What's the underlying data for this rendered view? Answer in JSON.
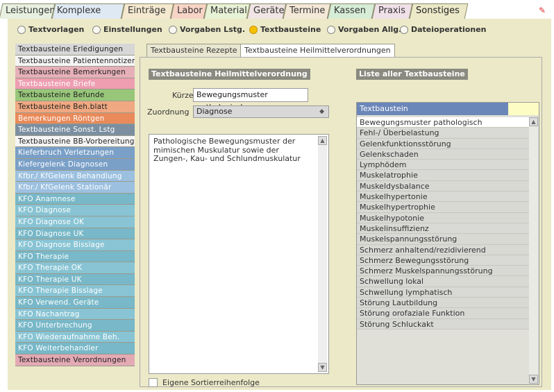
{
  "top_tabs": [
    {
      "label": "Leistungen",
      "color": "#e8f0e0",
      "active": false
    },
    {
      "label": "Komplexe POA",
      "color": "#dfe9f3",
      "active": false
    },
    {
      "label": "Einträge",
      "color": "#f4e9d0",
      "active": false
    },
    {
      "label": "Labor",
      "color": "#f7d4c6",
      "active": false
    },
    {
      "label": "Material",
      "color": "#e8f2d6",
      "active": false
    },
    {
      "label": "Geräte",
      "color": "#f0e4e4",
      "active": false
    },
    {
      "label": "Termine",
      "color": "#f4e8d8",
      "active": false
    },
    {
      "label": "Kassen",
      "color": "#d6ecd6",
      "active": false
    },
    {
      "label": "Praxis",
      "color": "#f0e0e8",
      "active": false
    },
    {
      "label": "Sonstiges",
      "color": "#ece9c8",
      "active": true
    }
  ],
  "radio_options": [
    {
      "label": "Textvorlagen",
      "selected": false
    },
    {
      "label": "Einstellungen",
      "selected": false
    },
    {
      "label": "Vorgaben Lstg.",
      "selected": false
    },
    {
      "label": "Textbausteine",
      "selected": true
    },
    {
      "label": "Vorgaben Allg.",
      "selected": false
    },
    {
      "label": "Dateioperationen",
      "selected": false
    }
  ],
  "left_list": [
    {
      "label": "Textbausteine Erledigungen",
      "cls": "c-grey"
    },
    {
      "label": "Textbausteine Patientennotizen",
      "cls": "c-white"
    },
    {
      "label": "Textbausteine Bemerkungen",
      "cls": "c-pink"
    },
    {
      "label": "Textbausteine Briefe",
      "cls": "c-rose"
    },
    {
      "label": "Textbausteine Befunde",
      "cls": "c-green"
    },
    {
      "label": "Textbausteine Beh.blatt",
      "cls": "c-orange"
    },
    {
      "label": "Bemerkungen Röntgen",
      "cls": "c-orange2"
    },
    {
      "label": "Textbausteine Sonst. Lstg",
      "cls": "c-slate"
    },
    {
      "label": "Textbausteine BB-Vorbereitung",
      "cls": "c-white"
    },
    {
      "label": "Kieferbruch Verletzungen",
      "cls": "c-blue"
    },
    {
      "label": "Kiefergelenk Diagnosen",
      "cls": "c-blue"
    },
    {
      "label": "Kfbr./ KfGelenk Behandlung",
      "cls": "c-lblue"
    },
    {
      "label": "Kfbr./ KfGelenk Stationär",
      "cls": "c-lblue"
    },
    {
      "label": "KFO Anamnese",
      "cls": "c-teal"
    },
    {
      "label": "KFO Diagnose",
      "cls": "c-teal2"
    },
    {
      "label": "KFO Diagnose OK",
      "cls": "c-teal2"
    },
    {
      "label": "KFO Diagnose UK",
      "cls": "c-teal"
    },
    {
      "label": "KFO Diagnose Bisslage",
      "cls": "c-teal2"
    },
    {
      "label": "KFO Therapie",
      "cls": "c-teal"
    },
    {
      "label": "KFO Therapie OK",
      "cls": "c-teal2"
    },
    {
      "label": "KFO Therapie UK",
      "cls": "c-teal"
    },
    {
      "label": "KFO Therapie Bisslage",
      "cls": "c-teal2"
    },
    {
      "label": "KFO Verwend. Geräte",
      "cls": "c-teal"
    },
    {
      "label": "KFO Nachantrag",
      "cls": "c-teal2"
    },
    {
      "label": "KFO Unterbrechung",
      "cls": "c-teal"
    },
    {
      "label": "KFO Wiederaufnahme Beh.",
      "cls": "c-teal2"
    },
    {
      "label": "KFO Weiterbehandler",
      "cls": "c-teal"
    },
    {
      "label": "Textbausteine Verordnungen",
      "cls": "c-last"
    }
  ],
  "sub_tabs": [
    {
      "label": "Textbausteine Rezepte",
      "active": false
    },
    {
      "label": "Textbausteine Heilmittelverordnungen",
      "active": true
    }
  ],
  "left_section": {
    "title": "Textbausteine Heilmittelverordnung",
    "kuerzel_label": "Kürzel",
    "kuerzel_value": "Bewegungsmuster pathologisch",
    "zuordnung_label": "Zuordnung",
    "zuordnung_value": "Diagnose",
    "text_body": "Pathologische Bewegungsmuster der mimischen Muskulatur sowie der Zungen-, Kau- und Schlundmuskulatur",
    "checkbox_label": "Eigene Sortierreihenfolge"
  },
  "right_section": {
    "title": "Liste aller Textbausteine",
    "header_label": "Textbaustein",
    "items": [
      {
        "label": "Bewegungsmuster pathologisch",
        "selected": true
      },
      {
        "label": "Fehl-/ Überbelastung",
        "selected": false
      },
      {
        "label": "Gelenkfunktionsstörung",
        "selected": false
      },
      {
        "label": "Gelenkschaden",
        "selected": false
      },
      {
        "label": "Lymphödem",
        "selected": false
      },
      {
        "label": "Muskelatrophie",
        "selected": false
      },
      {
        "label": "Muskeldysbalance",
        "selected": false
      },
      {
        "label": "Muskelhypertonie",
        "selected": false
      },
      {
        "label": "Muskelhypertrophie",
        "selected": false
      },
      {
        "label": "Muskelhypotonie",
        "selected": false
      },
      {
        "label": "Muskelinsuffizienz",
        "selected": false
      },
      {
        "label": "Muskelspannungsstörung",
        "selected": false
      },
      {
        "label": "Schmerz anhaltend/rezidivierend",
        "selected": false
      },
      {
        "label": "Schmerz Bewegungsstörung",
        "selected": false
      },
      {
        "label": "Schmerz Muskelspannungsstörung",
        "selected": false
      },
      {
        "label": "Schwellung lokal",
        "selected": false
      },
      {
        "label": "Schwellung lymphatisch",
        "selected": false
      },
      {
        "label": "Störung Lautbildung",
        "selected": false
      },
      {
        "label": "Störung orofaziale Funktion",
        "selected": false
      },
      {
        "label": "Störung Schluckakt",
        "selected": false
      }
    ]
  }
}
